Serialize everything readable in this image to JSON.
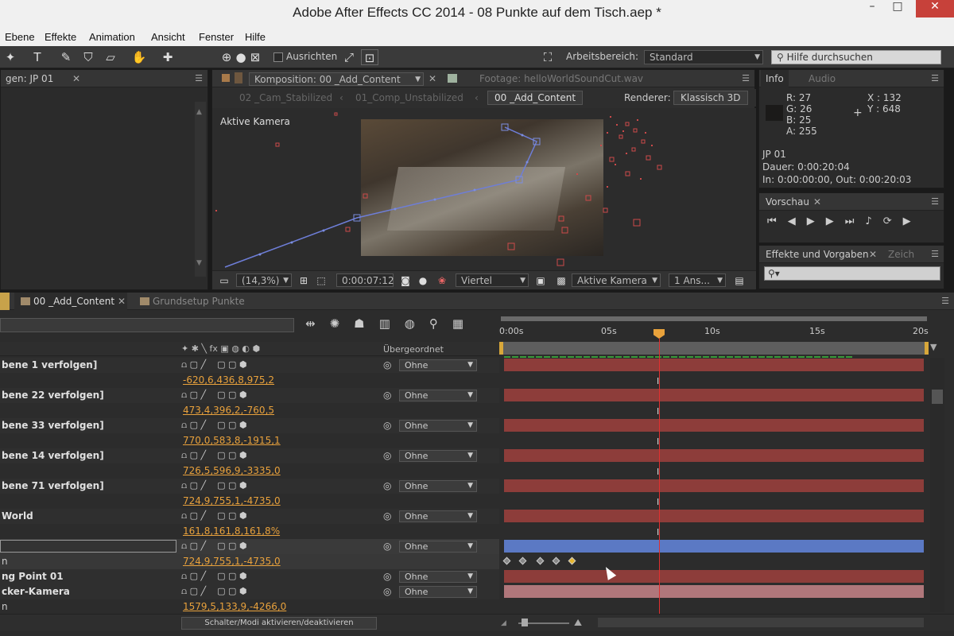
{
  "window": {
    "title": "Adobe After Effects CC 2014 - 08 Punkte auf dem Tisch.aep *"
  },
  "menu": [
    "Ebene",
    "Effekte",
    "Animation",
    "Ansicht",
    "Fenster",
    "Hilfe"
  ],
  "toolbar": {
    "snap_label": "Ausrichten",
    "workspace_label": "Arbeitsbereich:",
    "workspace_value": "Standard",
    "search_placeholder": "Hilfe durchsuchen"
  },
  "project_panel": {
    "tab": "gen: JP 01"
  },
  "composition_panel": {
    "tab": "Komposition: 00 _Add_Content",
    "footage_tab": "Footage: helloWorldSoundCut.wav",
    "breadcrumbs": [
      "02 _Cam_Stabilized",
      "01_Comp_Unstabilized",
      "00 _Add_Content"
    ],
    "renderer_label": "Renderer:",
    "renderer_value": "Klassisch 3D",
    "camera_label": "Aktive Kamera",
    "zoom": "(14,3%)",
    "timecode": "0:00:07:12",
    "resolution": "Viertel",
    "view": "Aktive Kamera",
    "views": "1 Ans..."
  },
  "info_panel": {
    "tabs": [
      "Info",
      "Audio"
    ],
    "r": "R: 27",
    "g": "G: 26",
    "b": "B: 25",
    "a": "A: 255",
    "x": "X : 132",
    "y": "Y : 648",
    "name": "JP 01",
    "duration": "Dauer: 0:00:20:04",
    "inout": "In: 0:00:00:00, Out: 0:00:20:03"
  },
  "preview_panel": {
    "tab": "Vorschau"
  },
  "effects_panel": {
    "tab": "Effekte und Vorgaben",
    "tab2": "Zeich"
  },
  "timeline": {
    "tabs": [
      "00 _Add_Content",
      "Grundsetup Punkte"
    ],
    "parent_header": "Übergeordnet",
    "ruler": [
      "0:00s",
      "05s",
      "10s",
      "15s",
      "20s"
    ],
    "toggle_label": "Schalter/Modi aktivieren/deaktivieren",
    "layers": [
      {
        "name": "bene 1 verfolgen]",
        "value": "-620,6,436,8,975,2",
        "parent": "Ohne",
        "bar": "red"
      },
      {
        "name": "bene 22 verfolgen]",
        "value": "473,4,396,2,-760,5",
        "parent": "Ohne",
        "bar": "red"
      },
      {
        "name": "bene 33 verfolgen]",
        "value": "770,0,583,8,-1915,1",
        "parent": "Ohne",
        "bar": "red"
      },
      {
        "name": "bene 14 verfolgen]",
        "value": "726,5,596,9,-3335,0",
        "parent": "Ohne",
        "bar": "red"
      },
      {
        "name": "bene 71 verfolgen]",
        "value": "724,9,755,1,-4735,0",
        "parent": "Ohne",
        "bar": "red"
      },
      {
        "name": "World",
        "value": "161,8,161,8,161,8%",
        "parent": "Ohne",
        "bar": "red"
      },
      {
        "name": "",
        "value": "724,9,755,1,-4735,0",
        "parent": "Ohne",
        "bar": "blue"
      },
      {
        "name": "ng Point 01",
        "value": "",
        "parent": "Ohne",
        "bar": "red"
      },
      {
        "name": "cker-Kamera",
        "value": "1579,5,133,9,-4266,0",
        "parent": "Ohne",
        "bar": "pink"
      }
    ],
    "sub_label": "n"
  }
}
